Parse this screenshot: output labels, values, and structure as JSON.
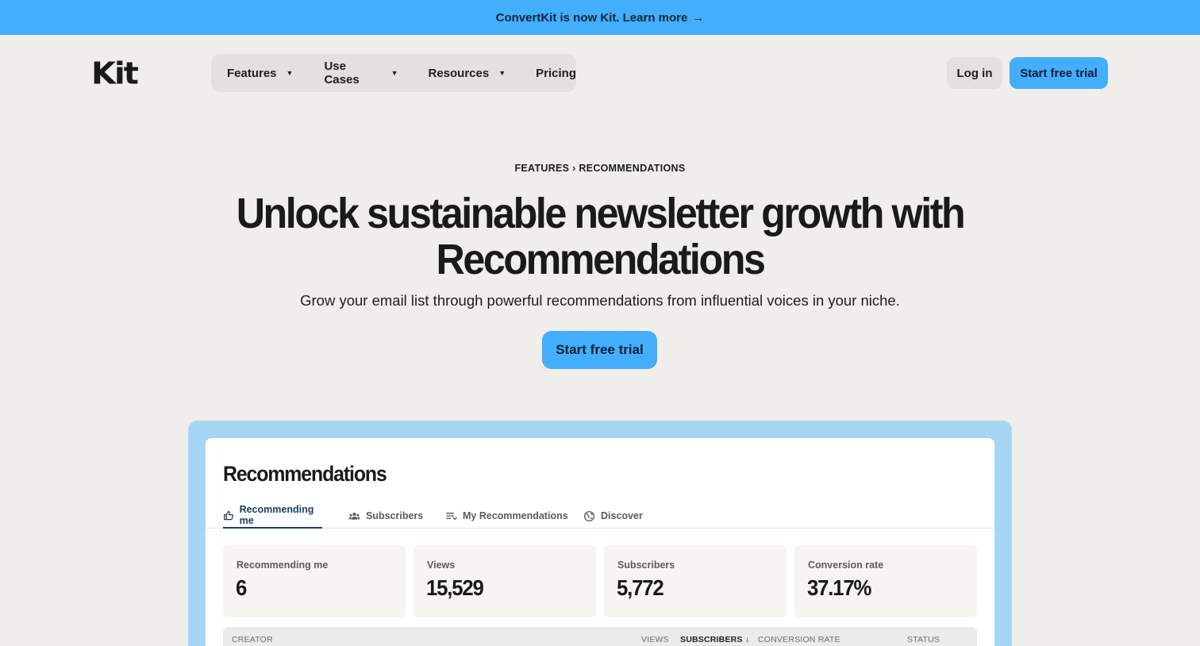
{
  "banner": {
    "text": "ConvertKit is now Kit. Learn more",
    "arrow": "→"
  },
  "logo": {
    "text": "Kit"
  },
  "nav": {
    "items": [
      {
        "label": "Features",
        "has_dropdown": true
      },
      {
        "label": "Use Cases",
        "has_dropdown": true
      },
      {
        "label": "Resources",
        "has_dropdown": true
      },
      {
        "label": "Pricing",
        "has_dropdown": false
      }
    ],
    "caret": "▼",
    "login_label": "Log in",
    "trial_label": "Start free trial"
  },
  "hero": {
    "breadcrumb": [
      "FEATURES",
      "RECOMMENDATIONS"
    ],
    "breadcrumb_sep": "›",
    "headline_line1": "Unlock sustainable newsletter growth with",
    "headline_line2": "Recommendations",
    "subhead": "Grow your email list through powerful recommendations from influential voices in your niche.",
    "cta_label": "Start free trial"
  },
  "dashboard": {
    "title": "Recommendations",
    "tabs": [
      {
        "label": "Recommending me",
        "icon": "thumbs-up-icon",
        "active": true
      },
      {
        "label": "Subscribers",
        "icon": "users-icon",
        "active": false
      },
      {
        "label": "My Recommendations",
        "icon": "list-icon",
        "active": false
      },
      {
        "label": "Discover",
        "icon": "globe-icon",
        "active": false
      }
    ],
    "stats": [
      {
        "label": "Recommending me",
        "value": "6"
      },
      {
        "label": "Views",
        "value": "15,529"
      },
      {
        "label": "Subscribers",
        "value": "5,772"
      },
      {
        "label": "Conversion rate",
        "value": "37.17%"
      }
    ],
    "table_headers": {
      "creator": "CREATOR",
      "views": "VIEWS",
      "subscribers": "SUBSCRIBERS",
      "sort_arrow": "↓",
      "conversion": "CONVERSION RATE",
      "status": "STATUS"
    }
  },
  "colors": {
    "accent": "#42aefc",
    "background": "#efeeea",
    "frame": "#a6d5f3",
    "active_tab": "#1b3f66"
  }
}
